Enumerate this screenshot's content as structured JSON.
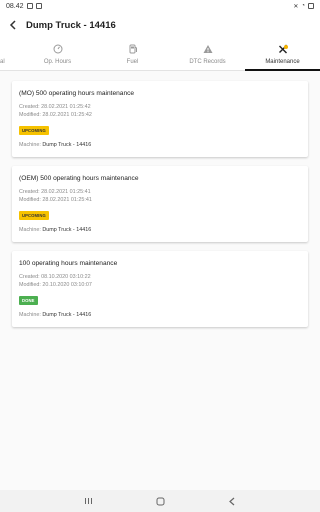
{
  "status": {
    "time": "08.42",
    "battery": ""
  },
  "appbar": {
    "title": "Dump Truck - 14416"
  },
  "tabs": [
    {
      "label": "ral",
      "icon": "general-icon",
      "active": false
    },
    {
      "label": "Op. Hours",
      "icon": "gauge-icon",
      "active": false
    },
    {
      "label": "Fuel",
      "icon": "fuel-icon",
      "active": false
    },
    {
      "label": "DTC Records",
      "icon": "warning-icon",
      "active": false
    },
    {
      "label": "Maintenance",
      "icon": "tools-icon",
      "active": true
    }
  ],
  "cards": [
    {
      "title": "(MO) 500 operating hours maintenance",
      "created": "Created: 28.02.2021 01:25:42",
      "modified": "Modified: 28.02.2021 01:25:42",
      "status": "UPCOMING",
      "machine_label": "Machine: ",
      "machine": "Dump Truck - 14416"
    },
    {
      "title": "(OEM) 500 operating hours maintenance",
      "created": "Created: 28.02.2021 01:25:41",
      "modified": "Modified: 28.02.2021 01:25:41",
      "status": "UPCOMING",
      "machine_label": "Machine: ",
      "machine": "Dump Truck - 14416"
    },
    {
      "title": "100 operating hours maintenance",
      "created": "Created: 08.10.2020 03:10:22",
      "modified": "Modified: 20.10.2020 03:10:07",
      "status": "DONE",
      "machine_label": "Machine: ",
      "machine": "Dump Truck - 14416"
    }
  ],
  "colors": {
    "upcoming": "#f6c200",
    "done": "#4caf50",
    "accent": "#f5b300"
  }
}
